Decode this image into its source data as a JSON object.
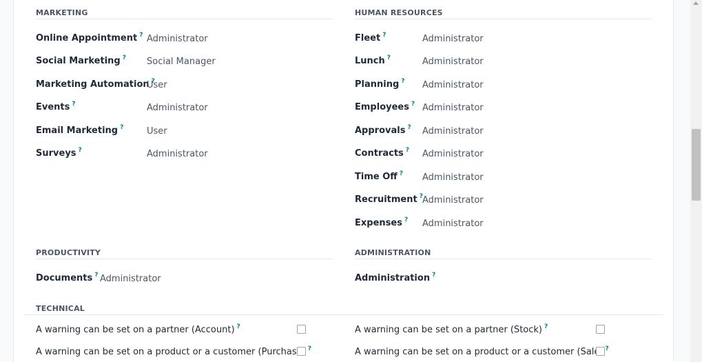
{
  "marketing": {
    "title": "MARKETING",
    "rows": [
      {
        "label": "Online Appointment",
        "value": "Administrator"
      },
      {
        "label": "Social Marketing",
        "value": "Social Manager"
      },
      {
        "label": "Marketing Automation",
        "value": "User"
      },
      {
        "label": "Events",
        "value": "Administrator"
      },
      {
        "label": "Email Marketing",
        "value": "User"
      },
      {
        "label": "Surveys",
        "value": "Administrator"
      }
    ]
  },
  "hr": {
    "title": "HUMAN RESOURCES",
    "rows": [
      {
        "label": "Fleet",
        "value": "Administrator"
      },
      {
        "label": "Lunch",
        "value": "Administrator"
      },
      {
        "label": "Planning",
        "value": "Administrator"
      },
      {
        "label": "Employees",
        "value": "Administrator"
      },
      {
        "label": "Approvals",
        "value": "Administrator"
      },
      {
        "label": "Contracts",
        "value": "Administrator"
      },
      {
        "label": "Time Off",
        "value": "Administrator"
      },
      {
        "label": "Recruitment",
        "value": "Administrator"
      },
      {
        "label": "Expenses",
        "value": "Administrator"
      }
    ]
  },
  "productivity": {
    "title": "PRODUCTIVITY",
    "rows": [
      {
        "label": "Documents",
        "value": "Administrator"
      }
    ]
  },
  "administration": {
    "title": "ADMINISTRATION",
    "rows": [
      {
        "label": "Administration",
        "value": ""
      }
    ]
  },
  "technical": {
    "title": "TECHNICAL",
    "left": [
      {
        "label": "A warning can be set on a partner (Account)",
        "checked": false
      },
      {
        "label": "A warning can be set on a product or a customer (Purchase)",
        "checked": false
      }
    ],
    "right": [
      {
        "label": "A warning can be set on a partner (Stock)",
        "checked": false
      },
      {
        "label": "A warning can be set on a product or a customer (Sale)",
        "checked": false
      }
    ]
  },
  "help_marker": "?",
  "colors": {
    "help": "#017e84",
    "rule": "#e5e7eb"
  }
}
